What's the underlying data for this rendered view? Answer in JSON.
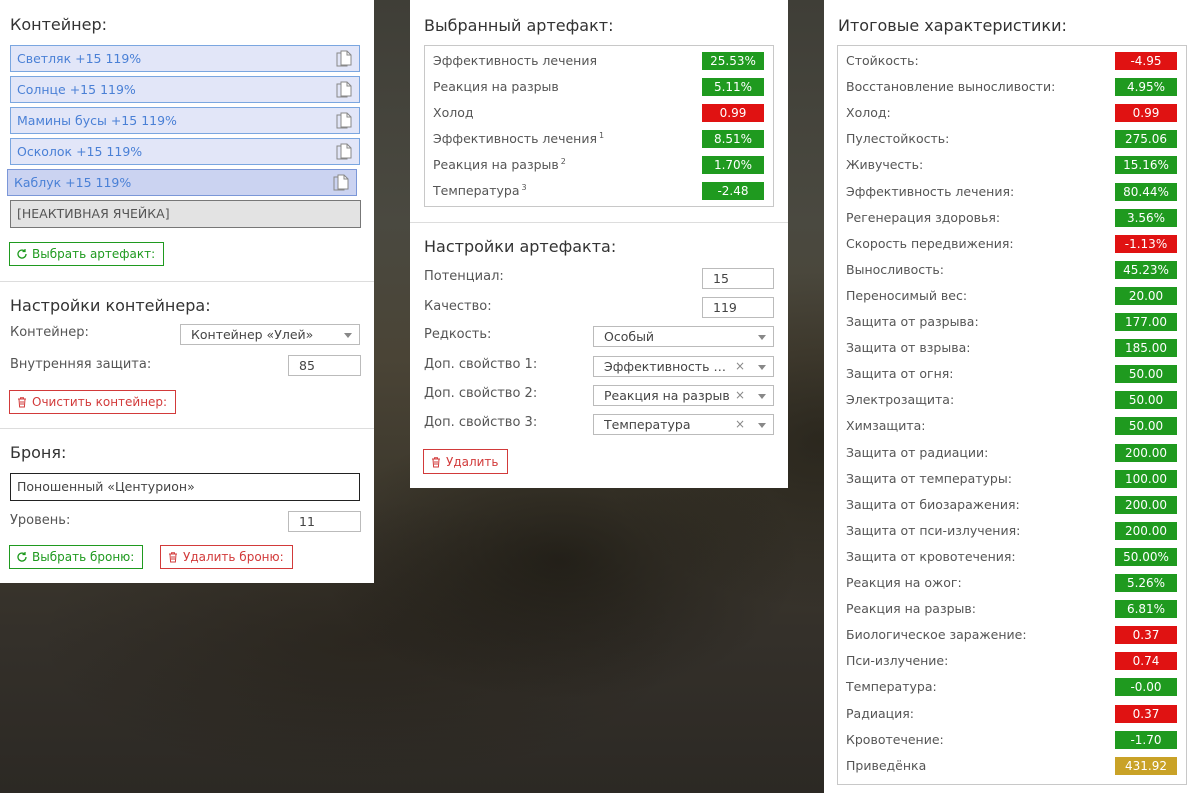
{
  "container": {
    "title": "Контейнер:",
    "slots": [
      "Светляк +15 119%",
      "Солнце +15 119%",
      "Мамины бусы +15 119%",
      "Осколок +15 119%",
      "Каблук +15 119%"
    ],
    "inactive": "[НЕАКТИВНАЯ ЯЧЕЙКА]",
    "choose_btn": "Выбрать артефакт:",
    "settings_title": "Настройки контейнера:",
    "container_label": "Контейнер:",
    "container_value": "Контейнер «Улей»",
    "protection_label": "Внутренняя защита:",
    "protection_value": "85",
    "clear_btn": "Очистить контейнер:"
  },
  "armor": {
    "title": "Броня:",
    "name": "Поношенный «Центурион»",
    "level_label": "Уровень:",
    "level_value": "11",
    "choose_btn": "Выбрать броню:",
    "delete_btn": "Удалить броню:"
  },
  "selected": {
    "title": "Выбранный артефакт:",
    "stats": [
      {
        "name": "Эффективность лечения",
        "sup": "",
        "value": "25.53%",
        "color": "green"
      },
      {
        "name": "Реакция на разрыв",
        "sup": "",
        "value": "5.11%",
        "color": "green"
      },
      {
        "name": "Холод",
        "sup": "",
        "value": "0.99",
        "color": "red"
      },
      {
        "name": "Эффективность лечения",
        "sup": "1",
        "value": "8.51%",
        "color": "green"
      },
      {
        "name": "Реакция на разрыв",
        "sup": "2",
        "value": "1.70%",
        "color": "green"
      },
      {
        "name": "Температура",
        "sup": "3",
        "value": "-2.48",
        "color": "green"
      }
    ],
    "settings_title": "Настройки артефакта:",
    "potential_label": "Потенциал:",
    "potential_value": "15",
    "quality_label": "Качество:",
    "quality_value": "119",
    "rarity_label": "Редкость:",
    "rarity_value": "Особый",
    "extra1_label": "Доп. свойство 1:",
    "extra1_value": "Эффективность лечения",
    "extra2_label": "Доп. свойство 2:",
    "extra2_value": "Реакция на разрыв",
    "extra3_label": "Доп. свойство 3:",
    "extra3_value": "Температура",
    "clear_symbol": "×",
    "delete_btn": "Удалить"
  },
  "totals": {
    "title": "Итоговые характеристики:",
    "stats": [
      {
        "name": "Стойкость:",
        "value": "-4.95",
        "color": "red"
      },
      {
        "name": "Восстановление выносливости:",
        "value": "4.95%",
        "color": "green"
      },
      {
        "name": "Холод:",
        "value": "0.99",
        "color": "red"
      },
      {
        "name": "Пулестойкость:",
        "value": "275.06",
        "color": "green"
      },
      {
        "name": "Живучесть:",
        "value": "15.16%",
        "color": "green"
      },
      {
        "name": "Эффективность лечения:",
        "value": "80.44%",
        "color": "green"
      },
      {
        "name": "Регенерация здоровья:",
        "value": "3.56%",
        "color": "green"
      },
      {
        "name": "Скорость передвижения:",
        "value": "-1.13%",
        "color": "red"
      },
      {
        "name": "Выносливость:",
        "value": "45.23%",
        "color": "green"
      },
      {
        "name": "Переносимый вес:",
        "value": "20.00",
        "color": "green"
      },
      {
        "name": "Защита от разрыва:",
        "value": "177.00",
        "color": "green"
      },
      {
        "name": "Защита от взрыва:",
        "value": "185.00",
        "color": "green"
      },
      {
        "name": "Защита от огня:",
        "value": "50.00",
        "color": "green"
      },
      {
        "name": "Электрозащита:",
        "value": "50.00",
        "color": "green"
      },
      {
        "name": "Химзащита:",
        "value": "50.00",
        "color": "green"
      },
      {
        "name": "Защита от радиации:",
        "value": "200.00",
        "color": "green"
      },
      {
        "name": "Защита от температуры:",
        "value": "100.00",
        "color": "green"
      },
      {
        "name": "Защита от биозаражения:",
        "value": "200.00",
        "color": "green"
      },
      {
        "name": "Защита от пси-излучения:",
        "value": "200.00",
        "color": "green"
      },
      {
        "name": "Защита от кровотечения:",
        "value": "50.00%",
        "color": "green"
      },
      {
        "name": "Реакция на ожог:",
        "value": "5.26%",
        "color": "green"
      },
      {
        "name": "Реакция на разрыв:",
        "value": "6.81%",
        "color": "green"
      },
      {
        "name": "Биологическое заражение:",
        "value": "0.37",
        "color": "red"
      },
      {
        "name": "Пси-излучение:",
        "value": "0.74",
        "color": "red"
      },
      {
        "name": "Температура:",
        "value": "-0.00",
        "color": "green"
      },
      {
        "name": "Радиация:",
        "value": "0.37",
        "color": "red"
      },
      {
        "name": "Кровотечение:",
        "value": "-1.70",
        "color": "green"
      },
      {
        "name": "Приведёнка",
        "value": "431.92",
        "color": "gold"
      }
    ]
  }
}
